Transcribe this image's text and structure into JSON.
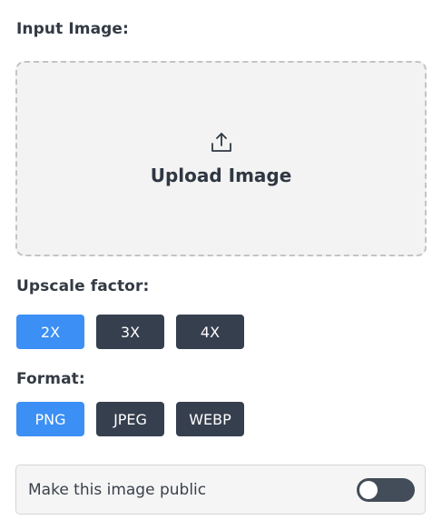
{
  "input_image": {
    "label": "Input Image:",
    "upload_text": "Upload Image",
    "icon": "upload-icon"
  },
  "upscale": {
    "label": "Upscale factor:",
    "options": [
      "2X",
      "3X",
      "4X"
    ],
    "selected": "2X"
  },
  "format": {
    "label": "Format:",
    "options": [
      "PNG",
      "JPEG",
      "WEBP"
    ],
    "selected": "PNG"
  },
  "public_toggle": {
    "label": "Make this image public",
    "enabled": false
  },
  "colors": {
    "accent": "#3b8ff5",
    "inactive_button": "#363f4e",
    "dropzone_bg": "#f3f3f3"
  }
}
